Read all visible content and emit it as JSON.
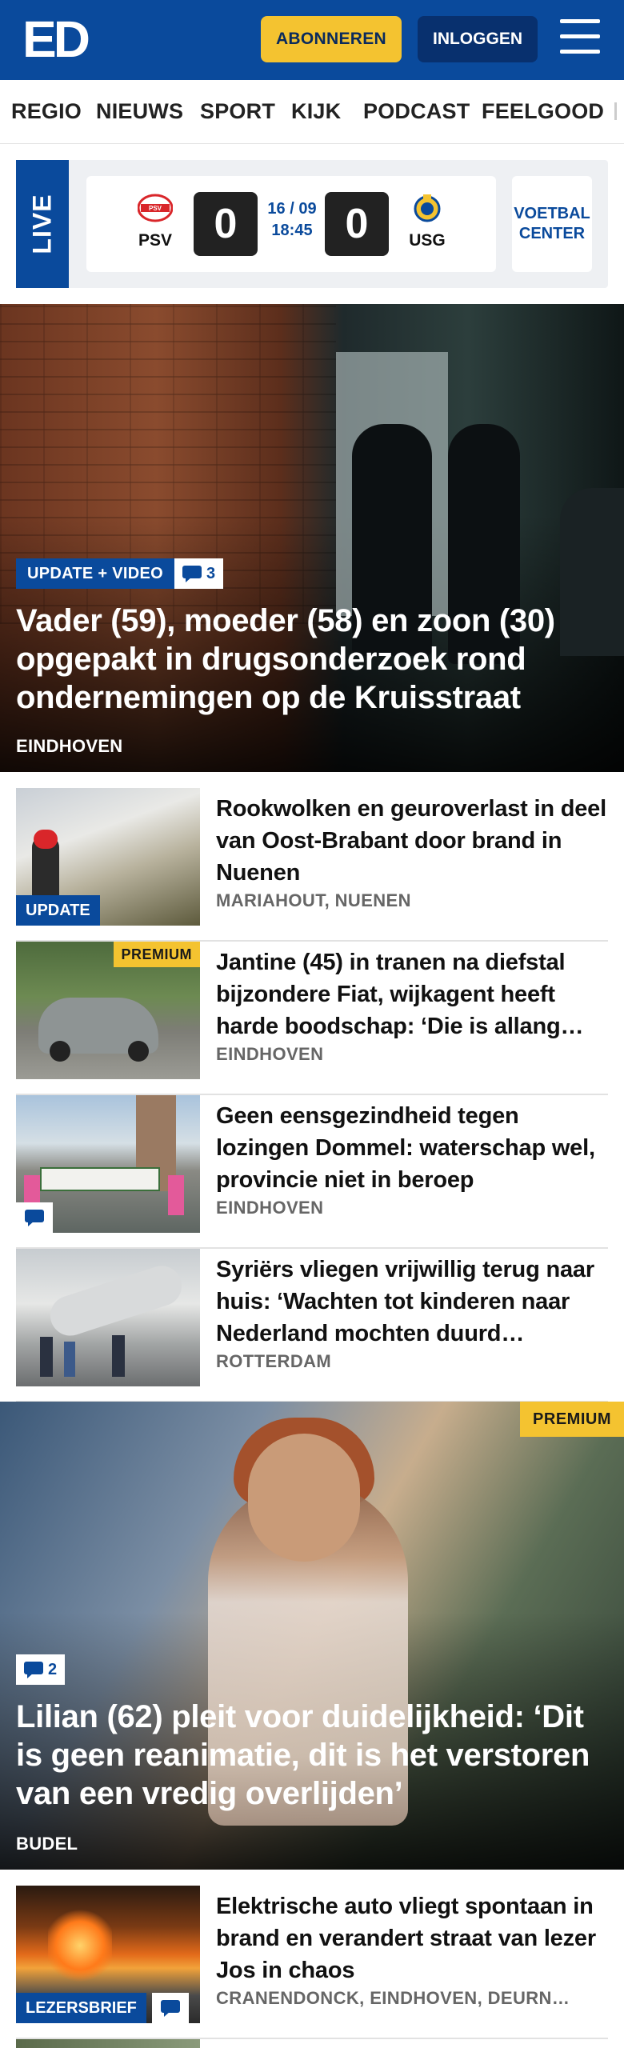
{
  "header": {
    "logo": "ED",
    "subscribe_label": "ABONNEREN",
    "login_label": "INLOGGEN",
    "brand_color": "#0a4a9c",
    "accent_color": "#f4c330"
  },
  "nav": {
    "items": [
      "REGIO",
      "NIEUWS",
      "SPORT",
      "KIJK",
      "PODCAST",
      "FEELGOOD"
    ]
  },
  "live": {
    "label": "LIVE",
    "match": {
      "home": "PSV",
      "away": "USG",
      "home_score": "0",
      "away_score": "0",
      "date": "16 / 09",
      "time": "18:45"
    },
    "voetbal_center": "VOETBAL CENTER"
  },
  "hero1": {
    "badge": "UPDATE + VIDEO",
    "comments": "3",
    "title": "Vader (59), moeder (58) en zoon (30) opgepakt in drugsonderzoek rond ondernemingen op de Kruisstraat",
    "location": "EINDHOVEN"
  },
  "articles": [
    {
      "title": "Rookwolken en geuroverlast in deel van Oost-Brabant door brand in Nuenen",
      "location": "MARIAHOUT, NUENEN",
      "badge": "UPDATE"
    },
    {
      "title": "Jantine (45) in tranen na diefstal bijzondere Fiat, wijkagent heeft harde boodschap: ‘Die is allang…",
      "location": "EINDHOVEN",
      "badge": "PREMIUM"
    },
    {
      "title": "Geen eensgezindheid tegen lozingen Dommel: waterschap wel, provincie niet in beroep",
      "location": "EINDHOVEN"
    },
    {
      "title": "Syriërs vliegen vrijwillig terug naar huis: ‘Wachten tot kinderen naar Nederland mochten duurd…",
      "location": "ROTTERDAM"
    }
  ],
  "hero2": {
    "premium": "PREMIUM",
    "comments": "2",
    "title": "Lilian (62) pleit voor duidelijkheid: ‘Dit is geen reanimatie, dit is het verstoren van een vredig overlijden’",
    "location": "BUDEL"
  },
  "articles2": [
    {
      "title": "Elektrische auto vliegt spontaan in brand en verandert straat van lezer Jos in chaos",
      "location": "CRANENDONCK, EINDHOVEN, DEURN…",
      "badge": "LEZERSBRIEF"
    }
  ]
}
